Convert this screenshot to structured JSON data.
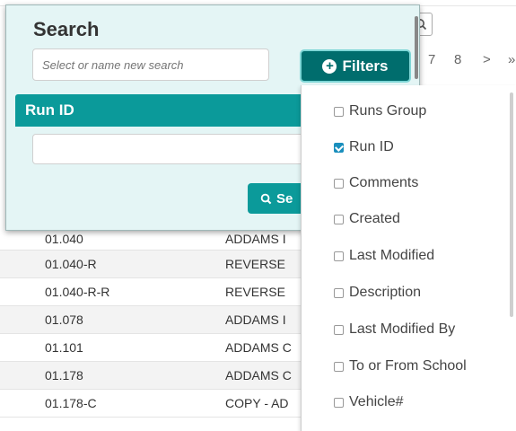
{
  "pager": {
    "p7": "7",
    "p8": "8",
    "next": ">",
    "last": "»"
  },
  "search_panel": {
    "title": "Search",
    "name_placeholder": "Select or name new search",
    "filters_label": "Filters",
    "field_label": "Run ID",
    "field_value": "",
    "search_button_label": "Se"
  },
  "filter_menu": {
    "items": [
      {
        "label": "Runs Group",
        "checked": false
      },
      {
        "label": "Run ID",
        "checked": true
      },
      {
        "label": "Comments",
        "checked": false
      },
      {
        "label": "Created",
        "checked": false
      },
      {
        "label": "Last Modified",
        "checked": false
      },
      {
        "label": "Description",
        "checked": false
      },
      {
        "label": "Last Modified By",
        "checked": false
      },
      {
        "label": "To or From School",
        "checked": false
      },
      {
        "label": "Vehicle#",
        "checked": false
      }
    ]
  },
  "table": {
    "rows": [
      {
        "run_id": "01.040",
        "desc": "ADDAMS I"
      },
      {
        "run_id": "01.040-R",
        "desc": "REVERSE"
      },
      {
        "run_id": "01.040-R-R",
        "desc": "REVERSE"
      },
      {
        "run_id": "01.078",
        "desc": "ADDAMS I"
      },
      {
        "run_id": "01.101",
        "desc": "ADDAMS C"
      },
      {
        "run_id": "01.178",
        "desc": "ADDAMS C"
      },
      {
        "run_id": "01.178-C",
        "desc": "COPY - AD"
      }
    ]
  }
}
